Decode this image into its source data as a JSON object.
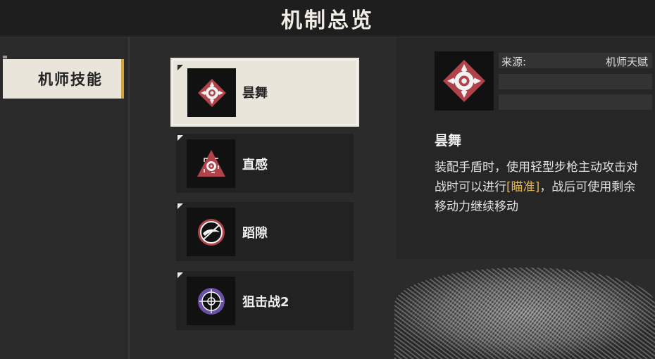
{
  "header": {
    "title": "机制总览"
  },
  "categories": [
    {
      "label": "机师技能",
      "selected": true
    }
  ],
  "skills": [
    {
      "name": "昙舞",
      "icon": "lotus-diamond-icon",
      "selected": true
    },
    {
      "name": "直感",
      "icon": "target-triangle-icon",
      "selected": false
    },
    {
      "name": "蹈隙",
      "icon": "slash-circle-icon",
      "selected": false
    },
    {
      "name": "狙击战2",
      "icon": "crosshair-icon",
      "selected": false
    }
  ],
  "detail": {
    "source_label": "来源:",
    "source_value": "机师天赋",
    "name": "昙舞",
    "desc_part1": "装配手盾时，使用轻型步枪主动攻击对战时可以进行",
    "desc_highlight": "[瞄准]",
    "desc_part2": "，战后可使用剩余移动力继续移动",
    "icon": "lotus-diamond-icon"
  },
  "colors": {
    "accent": "#d4a43a",
    "highlight": "#e3b34a",
    "icon_red": "#b0434a",
    "icon_purple": "#6a4fa8"
  }
}
